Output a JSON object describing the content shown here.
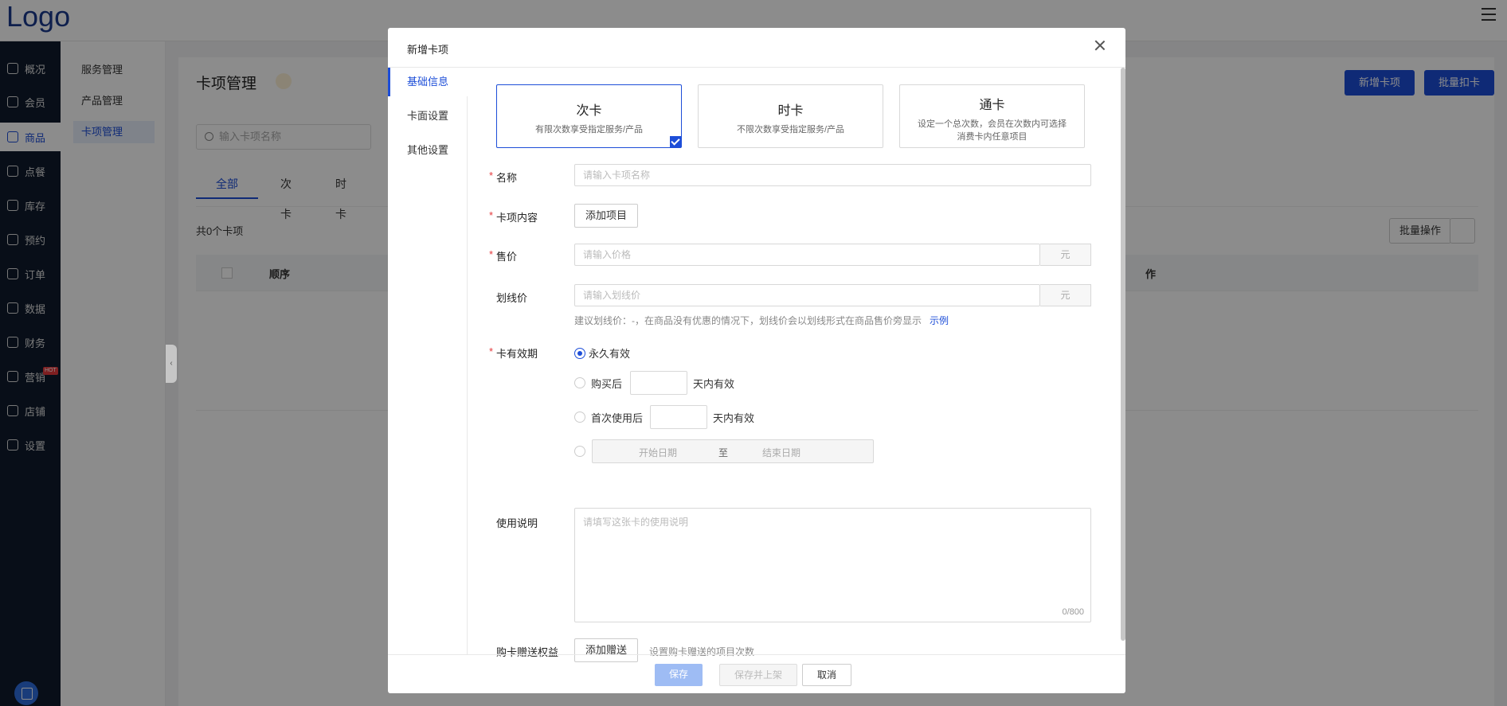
{
  "app": {
    "logo": "Logo"
  },
  "sidebar": {
    "items": [
      {
        "label": "概况"
      },
      {
        "label": "会员"
      },
      {
        "label": "商品"
      },
      {
        "label": "点餐"
      },
      {
        "label": "库存"
      },
      {
        "label": "预约"
      },
      {
        "label": "订单"
      },
      {
        "label": "数据"
      },
      {
        "label": "财务"
      },
      {
        "label": "营销",
        "badge": "HOT"
      },
      {
        "label": "店铺"
      },
      {
        "label": "设置"
      }
    ]
  },
  "subnav": {
    "items": [
      {
        "label": "服务管理"
      },
      {
        "label": "产品管理"
      },
      {
        "label": "卡项管理"
      }
    ]
  },
  "page": {
    "title": "卡项管理",
    "new_button": "新增卡项",
    "batch_deduct_button": "批量扣卡",
    "search_placeholder": "输入卡项名称",
    "tabs": [
      {
        "label": "全部"
      },
      {
        "label": "次卡"
      },
      {
        "label": "时卡"
      }
    ],
    "count_text": "共0个卡项",
    "batch_ops_button": "批量操作",
    "table_headers": {
      "order": "顺序",
      "ops_partial": "作"
    }
  },
  "modal": {
    "title": "新增卡项",
    "side_tabs": [
      {
        "label": "基础信息"
      },
      {
        "label": "卡面设置"
      },
      {
        "label": "其他设置"
      }
    ],
    "card_types": [
      {
        "title": "次卡",
        "desc": "有限次数享受指定服务/产品"
      },
      {
        "title": "时卡",
        "desc": "不限次数享受指定服务/产品"
      },
      {
        "title": "通卡",
        "desc": "设定一个总次数，会员在次数内可选择消费卡内任意项目"
      }
    ],
    "fields": {
      "name_label": "名称",
      "name_placeholder": "请输入卡项名称",
      "content_label": "卡项内容",
      "add_item_button": "添加项目",
      "price_label": "售价",
      "price_placeholder": "请输入价格",
      "price_unit": "元",
      "strike_label": "划线价",
      "strike_placeholder": "请输入划线价",
      "strike_unit": "元",
      "strike_hint": "建议划线价：-，在商品没有优惠的情况下，划线价会以划线形式在商品售价旁显示",
      "strike_example": "示例",
      "validity_label": "卡有效期",
      "validity_forever": "永久有效",
      "validity_after_buy": "购买后",
      "validity_after_first": "首次使用后",
      "validity_days_suffix": "天内有效",
      "date_start": "开始日期",
      "date_to": "至",
      "date_end": "结束日期",
      "usage_label": "使用说明",
      "usage_placeholder": "请填写这张卡的使用说明",
      "usage_counter": "0/800",
      "gift_label": "购卡赠送权益",
      "gift_button": "添加赠送",
      "gift_hint": "设置购卡赠送的项目次数"
    },
    "footer": {
      "save": "保存",
      "save_publish": "保存并上架",
      "cancel": "取消"
    }
  },
  "colors": {
    "primary": "#1d4ed8",
    "required": "#e5393c",
    "nav_bg": "#0f1a2c"
  }
}
